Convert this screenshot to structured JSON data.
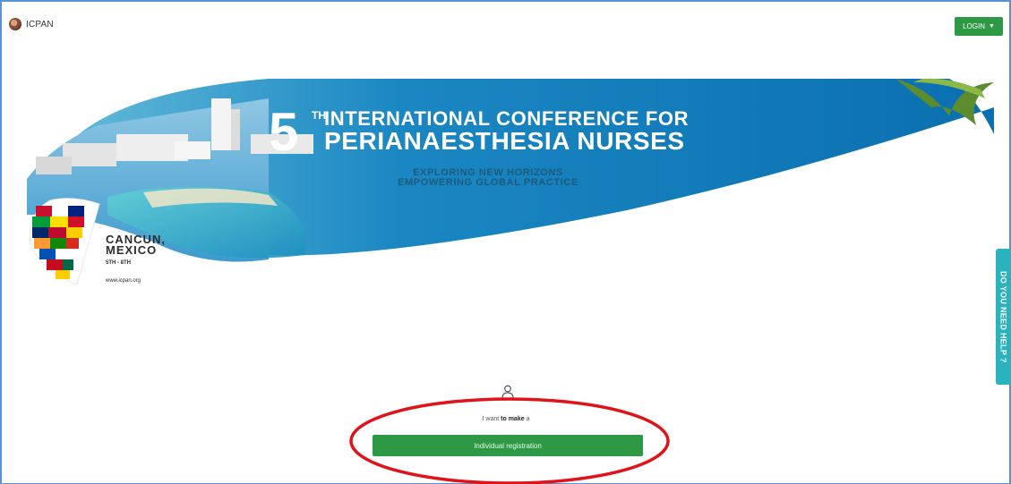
{
  "header": {
    "logo_text": "ICPAN",
    "login_label": "LOGIN"
  },
  "banner": {
    "ordinal": "5",
    "ordinal_suffix": "TH",
    "title_line1": "INTERNATIONAL CONFERENCE FOR",
    "title_line2": "PERIANAESTHESIA NURSES",
    "tagline_line1": "EXPLORING NEW HORIZONS",
    "tagline_line2": "EMPOWERING GLOBAL PRACTICE",
    "location_line1": "CANCUN,",
    "location_line2": "MEXICO",
    "dates": "5TH - 8TH",
    "website": "www.icpan.org"
  },
  "help_tab": {
    "label": "DO YOU NEED HELP ?"
  },
  "registration": {
    "prompt_prefix": "I want",
    "prompt_bold": "to make",
    "prompt_suffix": "a",
    "button_label": "Individual registration"
  },
  "colors": {
    "primary_green": "#2e9945",
    "help_teal": "#2ab3bd",
    "annotation_red": "#e0121a",
    "frame_blue": "#5b8fd6"
  },
  "icons": {
    "caret": "caret-down-icon",
    "user": "user-icon"
  }
}
